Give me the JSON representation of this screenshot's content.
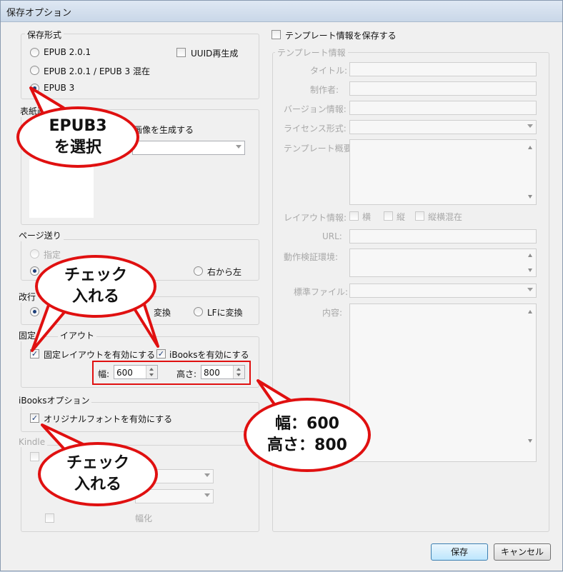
{
  "window": {
    "title": "保存オプション"
  },
  "save_format": {
    "legend": "保存形式",
    "options": [
      "EPUB 2.0.1",
      "EPUB 2.0.1 / EPUB 3 混在",
      "EPUB 3"
    ],
    "uuid_label": "UUID再生成"
  },
  "cover": {
    "legend_visible": "表紙画",
    "generate_label_visible": "画像を生成する"
  },
  "page_feed": {
    "legend": "ページ送り",
    "option_specified_visible": "指定",
    "option_rtl": "右から左"
  },
  "newline": {
    "legend_visible": "改行",
    "option_convert_visible": "変換",
    "option_lf": "LFに変換"
  },
  "fixed_layout": {
    "legend_left": "固定",
    "legend_right": "イアウト",
    "enable_label": "固定レイアウトを有効にする",
    "ibooks_label": "iBooksを有効にする",
    "width_label": "幅:",
    "width_value": "600",
    "height_label": "高さ:",
    "height_value": "800"
  },
  "ibooks_options": {
    "legend": "iBooksオプション",
    "original_font_label": "オリジナルフォントを有効にする"
  },
  "kindle": {
    "legend": "Kindle",
    "partial_label": "幅化"
  },
  "template": {
    "save_label": "テンプレート情報を保存する",
    "legend": "テンプレート情報",
    "title_label": "タイトル:",
    "author_label": "制作者:",
    "version_label": "バージョン情報:",
    "license_label": "ライセンス形式:",
    "summary_label": "テンプレート概要:",
    "layout_label": "レイアウト情報:",
    "layout_horizontal": "横",
    "layout_vertical": "縦",
    "layout_mixed": "縦横混在",
    "url_label": "URL:",
    "env_label": "動作検証環境:",
    "standard_file_label": "標準ファイル:",
    "content_label": "内容:"
  },
  "buttons": {
    "save": "保存",
    "cancel": "キャンセル"
  },
  "callouts": {
    "epub3_line1": "EPUB3",
    "epub3_line2": "を選択",
    "check1_line1": "チェック",
    "check1_line2": "入れる",
    "size_line1": "幅：600",
    "size_line2": "高さ：800",
    "check2_line1": "チェック",
    "check2_line2": "入れる"
  },
  "colors": {
    "callout_red": "#e01010",
    "accent_blue": "#1d3f7a"
  }
}
